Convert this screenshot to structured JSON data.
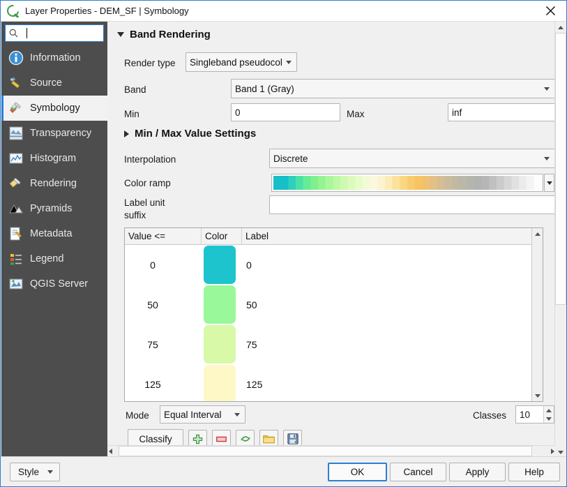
{
  "window": {
    "title": "Layer Properties - DEM_SF | Symbology",
    "close_label": "×",
    "logo_icon": "qgis-logo-icon"
  },
  "sidebar": {
    "search": {
      "value": "",
      "placeholder": "",
      "icon": "search-icon"
    },
    "items": [
      {
        "label": "Information",
        "icon": "information-icon",
        "selected": false
      },
      {
        "label": "Source",
        "icon": "source-icon",
        "selected": false
      },
      {
        "label": "Symbology",
        "icon": "symbology-icon",
        "selected": true
      },
      {
        "label": "Transparency",
        "icon": "transparency-icon",
        "selected": false
      },
      {
        "label": "Histogram",
        "icon": "histogram-icon",
        "selected": false
      },
      {
        "label": "Rendering",
        "icon": "rendering-icon",
        "selected": false
      },
      {
        "label": "Pyramids",
        "icon": "pyramids-icon",
        "selected": false
      },
      {
        "label": "Metadata",
        "icon": "metadata-icon",
        "selected": false
      },
      {
        "label": "Legend",
        "icon": "legend-icon",
        "selected": false
      },
      {
        "label": "QGIS Server",
        "icon": "qgis-server-icon",
        "selected": false
      }
    ]
  },
  "band_rendering": {
    "group_title": "Band Rendering",
    "render_type": {
      "label": "Render type",
      "value": "Singleband pseudocolor"
    },
    "band": {
      "label": "Band",
      "value": "Band 1 (Gray)"
    },
    "min": {
      "label": "Min",
      "value": "0"
    },
    "max": {
      "label": "Max",
      "value": "inf"
    },
    "min_max_settings": {
      "label": "Min / Max Value Settings"
    },
    "interpolation": {
      "label": "Interpolation",
      "value": "Discrete"
    },
    "color_ramp": {
      "label": "Color ramp",
      "value": "Spectral-like discrete ramp"
    },
    "label_unit_suffix": {
      "label": "Label unit\nsuffix",
      "label_line1": "Label unit",
      "label_line2": "suffix",
      "value": ""
    }
  },
  "classification": {
    "columns": [
      "Value <=",
      "Color",
      "Label"
    ],
    "rows": [
      {
        "value": "0",
        "color": "#1dc4cd",
        "label": "0"
      },
      {
        "value": "50",
        "color": "#99f89a",
        "label": "50"
      },
      {
        "value": "75",
        "color": "#d7f9a8",
        "label": "75"
      },
      {
        "value": "125",
        "color": "#fdf8c6",
        "label": "125"
      }
    ]
  },
  "mode_bar": {
    "mode_label": "Mode",
    "mode_value": "Equal Interval",
    "classes_label": "Classes",
    "classes_value": "10"
  },
  "toolbar": {
    "classify_label": "Classify",
    "buttons": [
      {
        "name": "add-entry-button",
        "icon": "plus-icon"
      },
      {
        "name": "remove-entry-button",
        "icon": "minus-icon"
      },
      {
        "name": "sort-entries-button",
        "icon": "refresh-icon"
      },
      {
        "name": "load-ramp-button",
        "icon": "folder-icon"
      },
      {
        "name": "save-ramp-button",
        "icon": "save-icon"
      }
    ]
  },
  "footer": {
    "style_label": "Style",
    "ok_label": "OK",
    "cancel_label": "Cancel",
    "apply_label": "Apply",
    "help_label": "Help"
  },
  "colors": {
    "accent": "#2a7fd4",
    "sidebar_bg": "#4d4d4d",
    "panel_bg": "#f0f0f0"
  },
  "color_ramp_stops": [
    "#17bfc9",
    "#17bfc9",
    "#2fd0bb",
    "#4ce0a7",
    "#66ec95",
    "#7ff08c",
    "#96f391",
    "#aaf69b",
    "#bdf8a6",
    "#cdf9b0",
    "#dbfbbc",
    "#e8fcca",
    "#f3fbd6",
    "#fbf8df",
    "#fdf3d0",
    "#fcecb8",
    "#fbe19a",
    "#fad682",
    "#f9cb6e",
    "#f6c463",
    "#eec270",
    "#e2c086",
    "#d6bd94",
    "#cbbb9d",
    "#c2b9a3",
    "#bab8a8",
    "#b4b6ad",
    "#b0b3b0",
    "#b6b6b6",
    "#c0c0c0",
    "#cbcbcb",
    "#d6d6d6",
    "#e1e1e1",
    "#ebebeb",
    "#f4f4f4",
    "#fdfdfd"
  ]
}
